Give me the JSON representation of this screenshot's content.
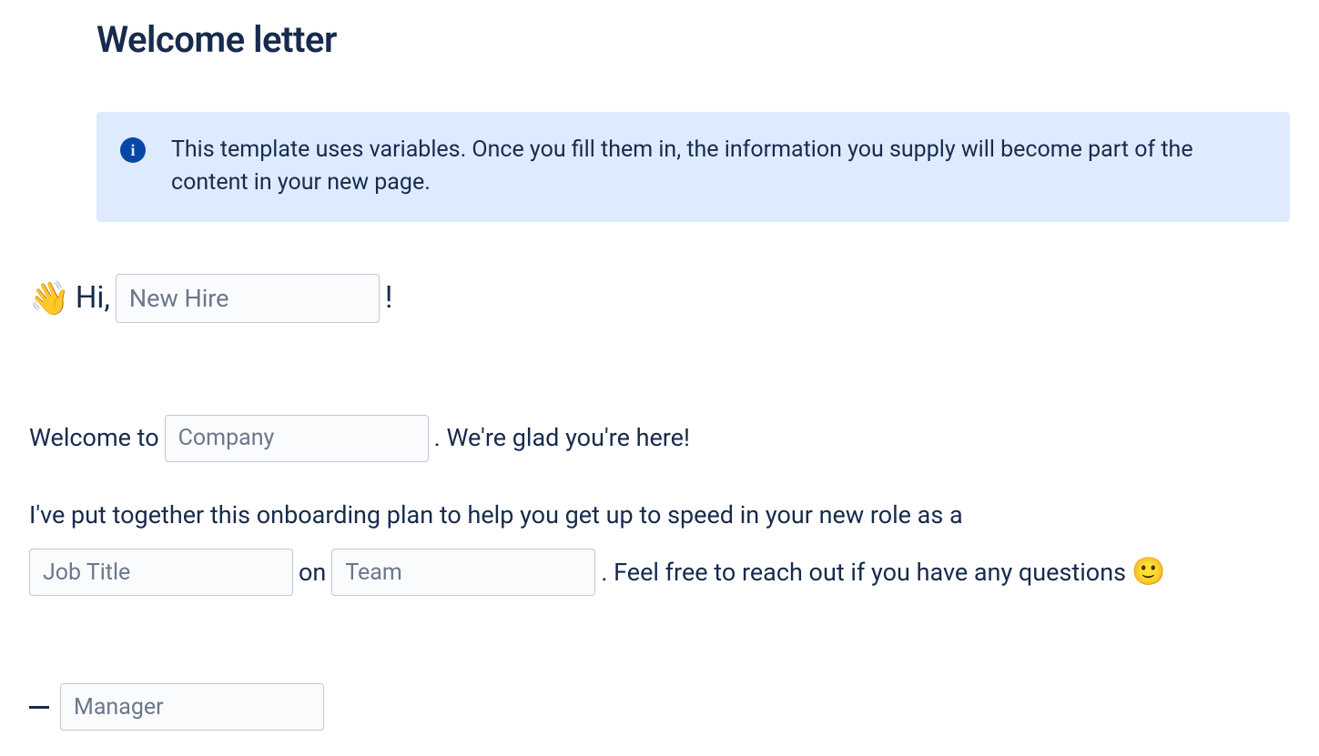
{
  "title": "Welcome letter",
  "banner": {
    "text": "This template uses variables. Once you fill them in, the information you supply will become part of the content in your new page."
  },
  "greeting": {
    "wave_emoji": "👋",
    "hi": "Hi,",
    "new_hire_placeholder": "New Hire",
    "exclaim": "!"
  },
  "welcome": {
    "prefix": "Welcome to",
    "company_placeholder": "Company",
    "suffix": ". We're glad you're here!"
  },
  "plan": {
    "intro": "I've put together this onboarding plan to help you get up to speed in your new role as a",
    "job_title_placeholder": "Job Title",
    "on": "on",
    "team_placeholder": "Team",
    "suffix": ". Feel free to reach out if you have any questions",
    "smile_emoji": "🙂"
  },
  "signoff": {
    "manager_placeholder": "Manager"
  }
}
